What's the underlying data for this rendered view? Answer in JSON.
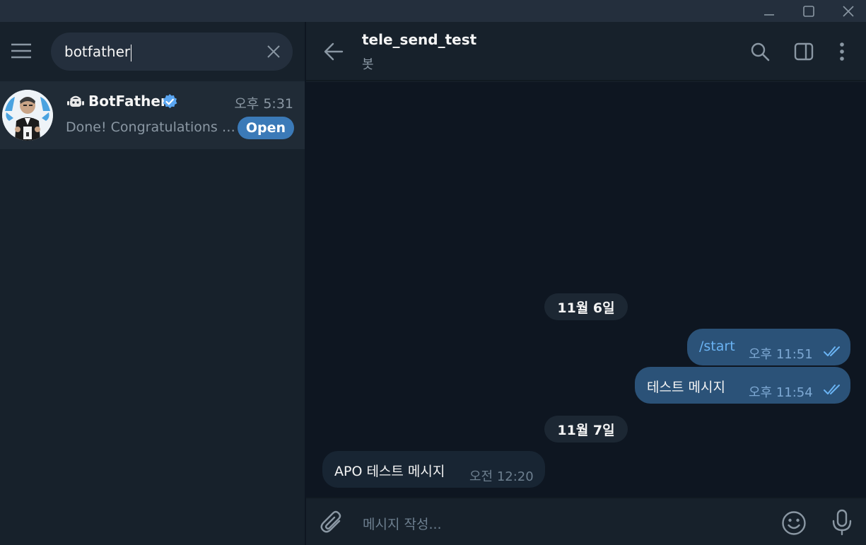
{
  "search": {
    "value": "botfather"
  },
  "chat_list": [
    {
      "name": "BotFather",
      "time": "오후 5:31",
      "preview": "Done! Congratulations on your new bot.",
      "button_label": "Open"
    }
  ],
  "header": {
    "title": "tele_send_test",
    "subtitle": "봇"
  },
  "messages": {
    "date1": "11월 6일",
    "m1": {
      "text": "/start",
      "time": "오후 11:51"
    },
    "m2": {
      "text": "테스트 메시지",
      "time": "오후 11:54"
    },
    "date2": "11월 7일",
    "m3": {
      "text": "APO 테스트 메시지",
      "time": "오전 12:20"
    }
  },
  "composer": {
    "placeholder": "메시지 작성..."
  },
  "colors": {
    "sidebar_bg": "#17212b",
    "chat_bg": "#0e1621",
    "outgoing_bubble": "#2b5278",
    "incoming_bubble": "#182533",
    "accent": "#3b7ab8",
    "command_link": "#6ab3f3",
    "verified_badge": "#5aa6f2"
  },
  "icons": [
    "minimize-icon",
    "maximize-icon",
    "close-icon",
    "hamburger-menu-icon",
    "clear-search-icon",
    "bot-icon",
    "verified-badge-icon",
    "back-arrow-icon",
    "search-icon",
    "sidebar-toggle-icon",
    "more-vertical-icon",
    "double-check-icon",
    "paperclip-icon",
    "emoji-icon",
    "microphone-icon"
  ]
}
